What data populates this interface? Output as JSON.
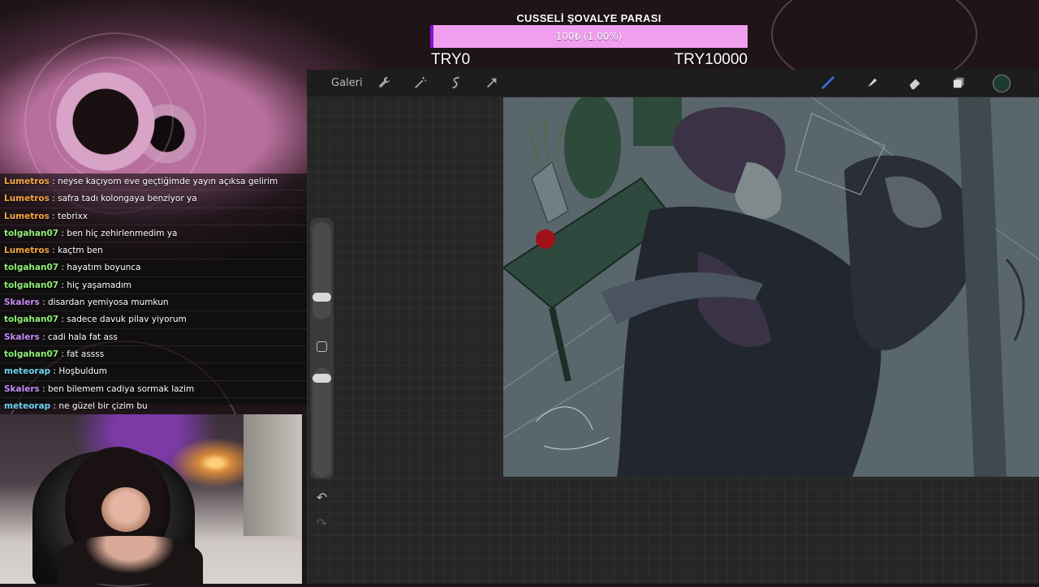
{
  "goal": {
    "title": "CUSSELİ ŞOVALYE PARASI",
    "progress_text": "100₺ (1.00%)",
    "progress_fraction": 0.01,
    "min_label": "TRY0",
    "max_label": "TRY10000",
    "bar_color": "#f09ef0",
    "fill_color": "#8a10d8"
  },
  "app": {
    "gallery_label": "Galeri",
    "toolbar_left_icons": [
      "wrench-icon",
      "magic-wand-icon",
      "selection-icon",
      "transform-arrow-icon"
    ],
    "toolbar_right_icons": [
      "brush-icon",
      "smudge-icon",
      "eraser-icon",
      "layers-icon"
    ],
    "active_color": "#1d3a30",
    "side_icons": [
      "modify-square-icon",
      "undo-icon",
      "redo-icon"
    ]
  },
  "chat": {
    "messages": [
      {
        "user": "Lumetros",
        "color": "#f4a640",
        "text": " : neyse kaçıyom eve geçtiğimde yayın açıksa gelirim"
      },
      {
        "user": "Lumetros",
        "color": "#f4a640",
        "text": " : safra tadı kolongaya benziyor ya"
      },
      {
        "user": "Lumetros",
        "color": "#f4a640",
        "text": " : tebrixx"
      },
      {
        "user": "tolgahan07",
        "color": "#8ef078",
        "text": " : ben hiç zehirlenmedim ya"
      },
      {
        "user": "Lumetros",
        "color": "#f4a640",
        "text": " : kaçtm ben"
      },
      {
        "user": "tolgahan07",
        "color": "#8ef078",
        "text": " : hayatım boyunca"
      },
      {
        "user": "tolgahan07",
        "color": "#8ef078",
        "text": " : hiç yaşamadım"
      },
      {
        "user": "Skalers",
        "color": "#c48cf5",
        "text": " : disardan yemiyosa mumkun"
      },
      {
        "user": "tolgahan07",
        "color": "#8ef078",
        "text": " : sadece davuk pilav yiyorum"
      },
      {
        "user": "Skalers",
        "color": "#c48cf5",
        "text": " : cadi hala fat ass"
      },
      {
        "user": "tolgahan07",
        "color": "#8ef078",
        "text": " : fat assss"
      },
      {
        "user": "meteorap",
        "color": "#6fd3f0",
        "text": " : Hoşbuldum"
      },
      {
        "user": "Skalers",
        "color": "#c48cf5",
        "text": " : ben bilemem cadiya sormak lazim"
      },
      {
        "user": "meteorap",
        "color": "#6fd3f0",
        "text": " : ne güzel bir çizim bu"
      }
    ]
  }
}
